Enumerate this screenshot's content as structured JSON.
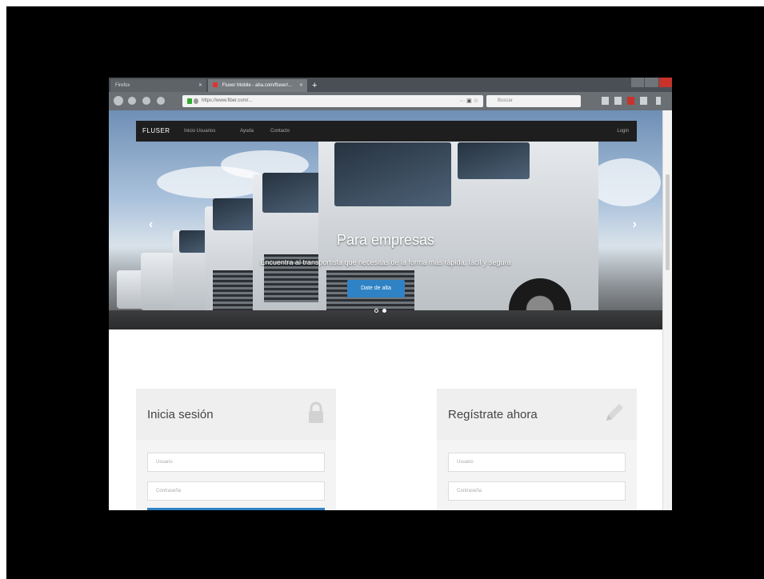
{
  "browser": {
    "tabs": [
      {
        "label": "Firefox",
        "active": false
      },
      {
        "label": "Fluxer Mobile - aba.com/fluxer/...",
        "active": true
      }
    ],
    "url": "https://www.fiber.com/...",
    "search_placeholder": "Buscar"
  },
  "site": {
    "brand": "FLUSER",
    "nav_links": [
      "Inicio Usuarios",
      "Ayuda",
      "Contacto"
    ],
    "login_link": "Login"
  },
  "hero": {
    "title": "Para empresas",
    "subtitle": "Encuentra al transportista que necesitas de la forma más rápida, fácil y segura",
    "cta": "Date de alta",
    "slide_count": 2,
    "active_slide": 1
  },
  "login_panel": {
    "title": "Inicia sesión",
    "icon": "lock-icon",
    "user_placeholder": "Usuario",
    "password_placeholder": "Contraseña"
  },
  "register_panel": {
    "title": "Regístrate ahora",
    "icon": "pencil-icon",
    "user_placeholder": "Usuario",
    "password_placeholder": "Contraseña"
  },
  "colors": {
    "accent": "#2f83c5",
    "nav_bg": "#1e1e1e"
  }
}
